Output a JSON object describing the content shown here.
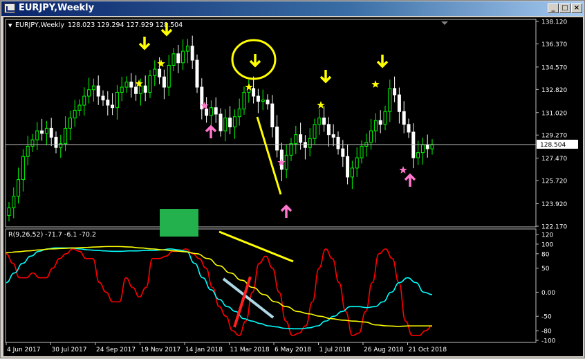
{
  "window": {
    "title": "EURJPY,Weekly",
    "buttons": [
      "_",
      "□",
      "×"
    ]
  },
  "chart_header": {
    "symbol_label": "EURJPY,Weekly",
    "ohlc": "128.023 129.294 127.929 128.504"
  },
  "indicator_header": "R(9,26,52) -71.7 -6.1 -70.2",
  "colors": {
    "background": "#000000",
    "bull_candle": "#00ff00",
    "bear_candle": "#ffffff",
    "price_line": "#c0c0c0",
    "red_line": "#ff0000",
    "cyan_line": "#00ffff",
    "yellow_line": "#ffff00",
    "annotation_yellow": "#ffff00",
    "annotation_pink": "#ff77cc",
    "annotation_green": "#22b14c",
    "annotation_lightblue": "#add8e6"
  },
  "chart_data": [
    {
      "type": "candlestick",
      "title": "EURJPY,Weekly",
      "y_ticks": [
        "138.120",
        "136.370",
        "134.570",
        "132.820",
        "131.020",
        "129.270",
        "127.470",
        "125.720",
        "123.920",
        "122.170"
      ],
      "ylim": [
        122.17,
        138.12
      ],
      "current_price": "128.504",
      "x_ticks": [
        "4 Jun 2017",
        "30 Jul 2017",
        "24 Sep 2017",
        "19 Nov 2017",
        "14 Jan 2018",
        "11 Mar 2018",
        "6 May 2018",
        "1 Jul 2018",
        "26 Aug 2018",
        "21 Oct 2018"
      ],
      "close": [
        123.6,
        124.5,
        125.8,
        127.6,
        128.4,
        128.9,
        129.6,
        129.4,
        129.8,
        129.1,
        128.3,
        128.6,
        129.8,
        130.6,
        131.2,
        131.6,
        132.3,
        132.8,
        133.1,
        132.3,
        132.0,
        131.6,
        131.4,
        132.6,
        133.0,
        133.4,
        133.0,
        132.5,
        133.1,
        132.6,
        133.9,
        134.4,
        133.8,
        133.0,
        134.7,
        135.6,
        134.9,
        135.8,
        136.2,
        135.1,
        133.0,
        131.3,
        130.8,
        131.4,
        130.9,
        129.6,
        130.6,
        129.9,
        130.7,
        131.3,
        132.6,
        132.9,
        132.3,
        131.9,
        132.0,
        131.7,
        129.9,
        128.1,
        126.6,
        127.7,
        128.6,
        129.3,
        128.7,
        128.3,
        129.0,
        130.1,
        130.6,
        130.1,
        129.3,
        129.1,
        128.2,
        127.6,
        126.0,
        126.7,
        127.5,
        128.4,
        128.7,
        129.6,
        130.4,
        130.1,
        131.1,
        132.9,
        132.4,
        131.1,
        130.1,
        129.5,
        127.5,
        127.9,
        128.5,
        128.2,
        128.5
      ]
    },
    {
      "type": "line",
      "title": "R(9,26,52) -71.7 -6.1 -70.2",
      "y_ticks": [
        "120",
        "100",
        "80",
        "50",
        "0.00",
        "-50",
        "-80",
        "-100"
      ],
      "ylim": [
        -100,
        120
      ],
      "series": [
        {
          "color": "#ff0000",
          "values": [
            80,
            60,
            30,
            30,
            40,
            30,
            30,
            50,
            70,
            80,
            90,
            85,
            70,
            70,
            20,
            0,
            -20,
            -20,
            30,
            10,
            -10,
            10,
            70,
            70,
            75,
            85,
            85,
            90,
            80,
            70,
            50,
            10,
            -30,
            -50,
            -80,
            -90,
            -60,
            0,
            60,
            75,
            50,
            0,
            -60,
            -90,
            -85,
            -70,
            -20,
            50,
            90,
            70,
            20,
            -40,
            -90,
            -85,
            -40,
            20,
            80,
            90,
            70,
            20,
            -60,
            -90,
            -90,
            -80,
            -70
          ]
        },
        {
          "color": "#00ffff",
          "values": [
            20,
            40,
            60,
            75,
            85,
            90,
            92,
            92,
            92,
            90,
            88,
            87,
            86,
            85,
            85,
            86,
            86,
            87,
            87,
            88,
            90,
            88,
            85,
            60,
            30,
            5,
            -15,
            -30,
            -40,
            -55,
            -60,
            -65,
            -70,
            -72,
            -75,
            -76,
            -76,
            -74,
            -70,
            -60,
            -50,
            -40,
            -30,
            -30,
            -32,
            -30,
            -20,
            0,
            20,
            30,
            20,
            0,
            -5
          ]
        },
        {
          "color": "#ffff00",
          "values": [
            82,
            84,
            86,
            88,
            90,
            91,
            92,
            93,
            94,
            95,
            95,
            94,
            92,
            90,
            88,
            86,
            84,
            80,
            70,
            55,
            40,
            25,
            10,
            -5,
            -20,
            -30,
            -40,
            -45,
            -50,
            -55,
            -58,
            -60,
            -62,
            -68,
            -70,
            -71,
            -70,
            -70,
            -70
          ]
        }
      ]
    }
  ]
}
